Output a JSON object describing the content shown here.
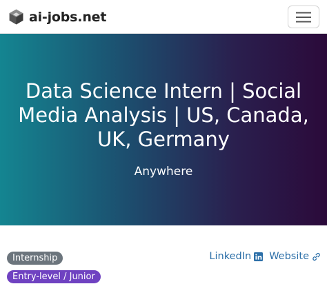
{
  "navbar": {
    "brand_name": "ai-jobs.net",
    "logo_icon": "hexagon-cube-logo-icon",
    "menu_icon": "hamburger-menu-icon"
  },
  "hero": {
    "title": "Data Science Intern | Social Media Analysis | US, Canada, UK, Germany",
    "location": "Anywhere"
  },
  "badges": {
    "job_type": "Internship",
    "level": "Entry-level / Junior"
  },
  "links": {
    "linkedin_label": "LinkedIn",
    "linkedin_icon": "linkedin-icon",
    "website_label": "Website",
    "website_icon": "external-link-icon"
  },
  "colors": {
    "link": "#2c6fa8",
    "badge_internship": "#6c757d",
    "badge_level": "#6f42c1",
    "hero_gradient_start": "#148591",
    "hero_gradient_end": "#2b0a3a"
  }
}
